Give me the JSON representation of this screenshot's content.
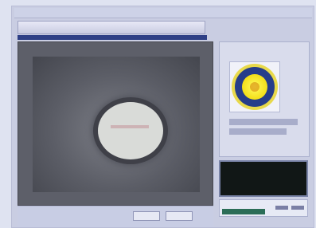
{
  "window": {
    "title": ""
  },
  "viewer": {
    "caption": "",
    "buttons": [
      "",
      ""
    ]
  },
  "side": {
    "title": "",
    "caption": "",
    "subcaption": ""
  },
  "readout": {
    "value": ""
  },
  "colors": {
    "accent": "#2e3f86",
    "frame": "#c9cde2",
    "readout_green": "#3df56a",
    "sun_yellow": "#f3df18"
  }
}
